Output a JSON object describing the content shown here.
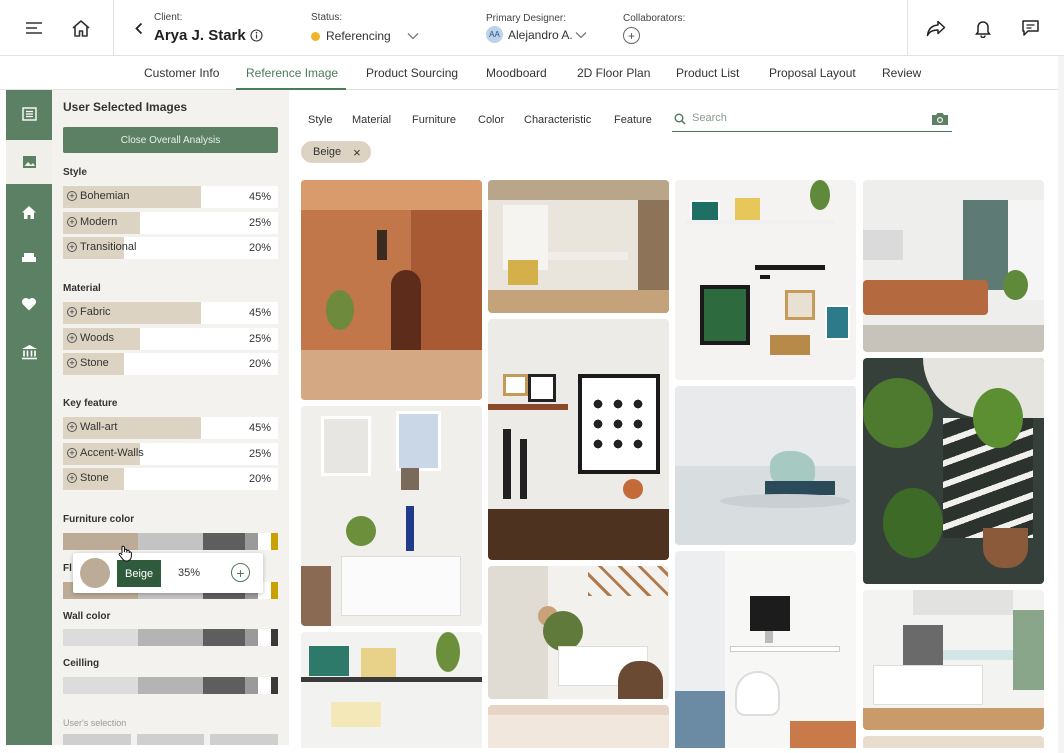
{
  "header": {
    "client_label": "Client:",
    "client_name": "Arya J. Stark",
    "status_label": "Status:",
    "status_value": "Referencing",
    "status_color": "#f0b429",
    "designer_label": "Primary Designer:",
    "designer_initials": "AA",
    "designer_name": "Alejandro A.",
    "collaborators_label": "Collaborators:",
    "icons": [
      "menu-icon",
      "home-icon",
      "back-icon",
      "info-icon",
      "share-icon",
      "bell-icon",
      "chat-icon"
    ]
  },
  "tabs": [
    {
      "label": "Customer Info"
    },
    {
      "label": "Reference Image",
      "active": true
    },
    {
      "label": "Product Sourcing"
    },
    {
      "label": "Moodboard"
    },
    {
      "label": "2D Floor Plan"
    },
    {
      "label": "Product List"
    },
    {
      "label": "Proposal Layout"
    },
    {
      "label": "Review"
    }
  ],
  "rail": {
    "items": [
      "list-icon",
      "image-icon",
      "home-icon",
      "sofa-icon",
      "heart-icon",
      "bank-icon"
    ],
    "active": "image-icon"
  },
  "panel": {
    "title": "User Selected Images",
    "close_button": "Close Overall Analysis",
    "sections": [
      {
        "title": "Style",
        "rows": [
          {
            "label": "Bohemian",
            "pct": "45%",
            "value": 0.45
          },
          {
            "label": "Modern",
            "pct": "25%",
            "value": 0.25
          },
          {
            "label": "Transitional",
            "pct": "20%",
            "value": 0.2
          }
        ]
      },
      {
        "title": "Material",
        "rows": [
          {
            "label": "Fabric",
            "pct": "45%",
            "value": 0.45
          },
          {
            "label": "Woods",
            "pct": "25%",
            "value": 0.25
          },
          {
            "label": "Stone",
            "pct": "20%",
            "value": 0.2
          }
        ]
      },
      {
        "title": "Key feature",
        "rows": [
          {
            "label": "Wall-art",
            "pct": "45%",
            "value": 0.45
          },
          {
            "label": "Accent-Walls",
            "pct": "25%",
            "value": 0.25
          },
          {
            "label": "Stone",
            "pct": "20%",
            "value": 0.2
          }
        ]
      }
    ],
    "color_sections": [
      {
        "title": "Furniture color"
      },
      {
        "title": "Fl"
      },
      {
        "title": "Wall color"
      },
      {
        "title": "Ceilling"
      }
    ],
    "tooltip": {
      "color_name": "Beige",
      "pct": "35%",
      "swatch": "#bcab96"
    },
    "user_selection_label": "User's selection"
  },
  "filters": {
    "items": [
      "Style",
      "Material",
      "Furniture",
      "Color",
      "Characteristic",
      "Feature"
    ],
    "search_placeholder": "Search",
    "active_chip": "Beige",
    "chip_close": "×"
  },
  "accent_color": "#5b8063",
  "images": {
    "col1": [
      "terracotta-hallway-image",
      "white-shelf-wall-art-image",
      "shelf-frames-image"
    ],
    "col2": [
      "dining-room-image",
      "oo-la-la-poster-shelf-image",
      "macrame-chair-corner-image",
      "ceiling-image"
    ],
    "col3": [
      "gallery-wall-image",
      "glass-sculpture-books-image",
      "white-desk-office-image"
    ],
    "col4": [
      "living-room-leather-sofa-image",
      "spiral-stair-plants-image",
      "white-kitchen-image"
    ]
  }
}
